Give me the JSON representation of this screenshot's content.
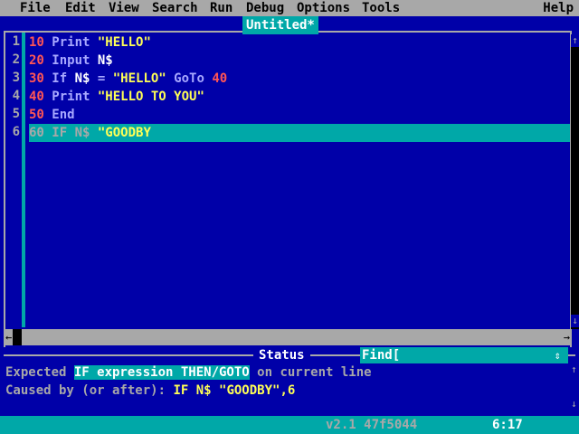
{
  "menu": {
    "items": [
      "File",
      "Edit",
      "View",
      "Search",
      "Run",
      "Debug",
      "Options",
      "Tools"
    ],
    "help": "Help"
  },
  "editor": {
    "title": "Untitled*",
    "line_numbers": [
      "1",
      "2",
      "3",
      "4",
      "5",
      "6"
    ],
    "lines": [
      [
        {
          "t": "10",
          "c": "num"
        },
        {
          "t": " Print ",
          "c": "kw"
        },
        {
          "t": "\"HELLO\"",
          "c": "str"
        }
      ],
      [
        {
          "t": "20",
          "c": "num"
        },
        {
          "t": " Input ",
          "c": "kw"
        },
        {
          "t": "N$",
          "c": "var"
        }
      ],
      [
        {
          "t": "30",
          "c": "num"
        },
        {
          "t": " If ",
          "c": "kw"
        },
        {
          "t": "N$",
          "c": "var"
        },
        {
          "t": " = ",
          "c": "kw"
        },
        {
          "t": "\"HELLO\"",
          "c": "str"
        },
        {
          "t": " GoTo ",
          "c": "kw"
        },
        {
          "t": "40",
          "c": "num"
        }
      ],
      [
        {
          "t": "40",
          "c": "num"
        },
        {
          "t": " Print ",
          "c": "kw"
        },
        {
          "t": "\"HELLO TO YOU\"",
          "c": "str"
        }
      ],
      [
        {
          "t": "50",
          "c": "num"
        },
        {
          "t": " End",
          "c": "kw"
        }
      ],
      [
        {
          "t": "60",
          "c": "act"
        },
        {
          "t": " IF ",
          "c": "act"
        },
        {
          "t": "N$",
          "c": "act"
        },
        {
          "t": " \"GOODBY",
          "c": "str"
        }
      ]
    ],
    "active_line": 6
  },
  "status_panel": {
    "label": "Status",
    "find_label": "Find[",
    "message_line1_prefix": "Expected ",
    "message_line1_highlight": "IF expression THEN/GOTO",
    "message_line1_suffix": " on current line",
    "message_line2_prefix": "Caused by (or after): ",
    "message_line2_code": "IF N$ \"GOODBY\",6"
  },
  "bottom": {
    "version": "v2.1 47f5044",
    "cursor_position": "6:17"
  },
  "icons": {
    "up": "up-arrow-icon",
    "down": "down-arrow-icon",
    "left": "left-arrow-icon",
    "right": "right-arrow-icon"
  },
  "colors": {
    "background": "#0000a8",
    "menubar": "#a8a8a8",
    "accent": "#00a8a8"
  }
}
